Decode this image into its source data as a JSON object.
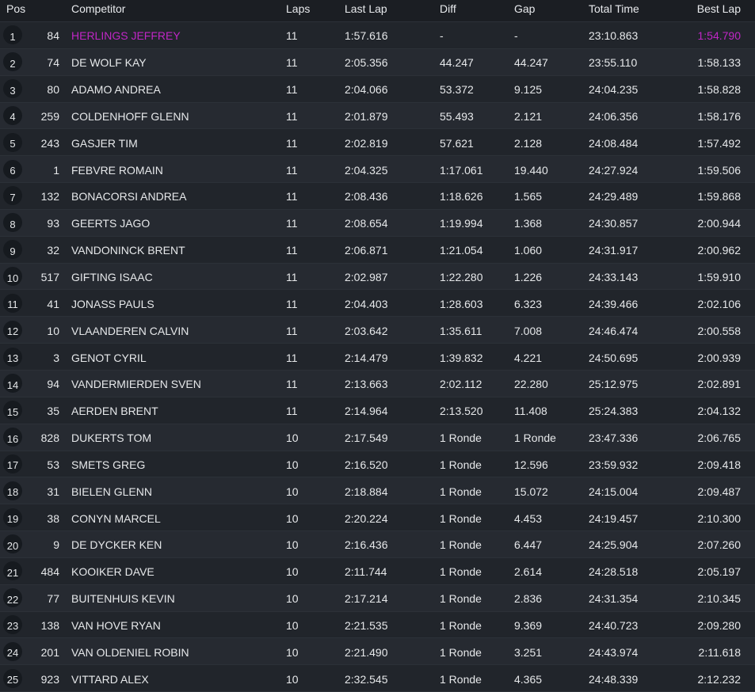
{
  "table": {
    "columns": {
      "pos": "Pos",
      "competitor": "Competitor",
      "laps": "Laps",
      "last_lap": "Last Lap",
      "diff": "Diff",
      "gap": "Gap",
      "total_time": "Total Time",
      "best_lap": "Best Lap"
    },
    "highlight_color": "#c026c6",
    "rows": [
      {
        "pos": "1",
        "number": "84",
        "name": "HERLINGS JEFFREY",
        "laps": "11",
        "last_lap": "1:57.616",
        "diff": "-",
        "gap": "-",
        "total_time": "23:10.863",
        "best_lap": "1:54.790"
      },
      {
        "pos": "2",
        "number": "74",
        "name": "DE WOLF KAY",
        "laps": "11",
        "last_lap": "2:05.356",
        "diff": "44.247",
        "gap": "44.247",
        "total_time": "23:55.110",
        "best_lap": "1:58.133"
      },
      {
        "pos": "3",
        "number": "80",
        "name": "ADAMO ANDREA",
        "laps": "11",
        "last_lap": "2:04.066",
        "diff": "53.372",
        "gap": "9.125",
        "total_time": "24:04.235",
        "best_lap": "1:58.828"
      },
      {
        "pos": "4",
        "number": "259",
        "name": "COLDENHOFF GLENN",
        "laps": "11",
        "last_lap": "2:01.879",
        "diff": "55.493",
        "gap": "2.121",
        "total_time": "24:06.356",
        "best_lap": "1:58.176"
      },
      {
        "pos": "5",
        "number": "243",
        "name": "GASJER TIM",
        "laps": "11",
        "last_lap": "2:02.819",
        "diff": "57.621",
        "gap": "2.128",
        "total_time": "24:08.484",
        "best_lap": "1:57.492"
      },
      {
        "pos": "6",
        "number": "1",
        "name": "FEBVRE ROMAIN",
        "laps": "11",
        "last_lap": "2:04.325",
        "diff": "1:17.061",
        "gap": "19.440",
        "total_time": "24:27.924",
        "best_lap": "1:59.506"
      },
      {
        "pos": "7",
        "number": "132",
        "name": "BONACORSI ANDREA",
        "laps": "11",
        "last_lap": "2:08.436",
        "diff": "1:18.626",
        "gap": "1.565",
        "total_time": "24:29.489",
        "best_lap": "1:59.868"
      },
      {
        "pos": "8",
        "number": "93",
        "name": "GEERTS JAGO",
        "laps": "11",
        "last_lap": "2:08.654",
        "diff": "1:19.994",
        "gap": "1.368",
        "total_time": "24:30.857",
        "best_lap": "2:00.944"
      },
      {
        "pos": "9",
        "number": "32",
        "name": "VANDONINCK BRENT",
        "laps": "11",
        "last_lap": "2:06.871",
        "diff": "1:21.054",
        "gap": "1.060",
        "total_time": "24:31.917",
        "best_lap": "2:00.962"
      },
      {
        "pos": "10",
        "number": "517",
        "name": "GIFTING ISAAC",
        "laps": "11",
        "last_lap": "2:02.987",
        "diff": "1:22.280",
        "gap": "1.226",
        "total_time": "24:33.143",
        "best_lap": "1:59.910"
      },
      {
        "pos": "11",
        "number": "41",
        "name": "JONASS PAULS",
        "laps": "11",
        "last_lap": "2:04.403",
        "diff": "1:28.603",
        "gap": "6.323",
        "total_time": "24:39.466",
        "best_lap": "2:02.106"
      },
      {
        "pos": "12",
        "number": "10",
        "name": "VLAANDEREN CALVIN",
        "laps": "11",
        "last_lap": "2:03.642",
        "diff": "1:35.611",
        "gap": "7.008",
        "total_time": "24:46.474",
        "best_lap": "2:00.558"
      },
      {
        "pos": "13",
        "number": "3",
        "name": "GENOT CYRIL",
        "laps": "11",
        "last_lap": "2:14.479",
        "diff": "1:39.832",
        "gap": "4.221",
        "total_time": "24:50.695",
        "best_lap": "2:00.939"
      },
      {
        "pos": "14",
        "number": "94",
        "name": "VANDERMIERDEN SVEN",
        "laps": "11",
        "last_lap": "2:13.663",
        "diff": "2:02.112",
        "gap": "22.280",
        "total_time": "25:12.975",
        "best_lap": "2:02.891"
      },
      {
        "pos": "15",
        "number": "35",
        "name": "AERDEN BRENT",
        "laps": "11",
        "last_lap": "2:14.964",
        "diff": "2:13.520",
        "gap": "11.408",
        "total_time": "25:24.383",
        "best_lap": "2:04.132"
      },
      {
        "pos": "16",
        "number": "828",
        "name": "DUKERTS TOM",
        "laps": "10",
        "last_lap": "2:17.549",
        "diff": "1 Ronde",
        "gap": "1 Ronde",
        "total_time": "23:47.336",
        "best_lap": "2:06.765"
      },
      {
        "pos": "17",
        "number": "53",
        "name": "SMETS GREG",
        "laps": "10",
        "last_lap": "2:16.520",
        "diff": "1 Ronde",
        "gap": "12.596",
        "total_time": "23:59.932",
        "best_lap": "2:09.418"
      },
      {
        "pos": "18",
        "number": "31",
        "name": "BIELEN GLENN",
        "laps": "10",
        "last_lap": "2:18.884",
        "diff": "1 Ronde",
        "gap": "15.072",
        "total_time": "24:15.004",
        "best_lap": "2:09.487"
      },
      {
        "pos": "19",
        "number": "38",
        "name": "CONYN MARCEL",
        "laps": "10",
        "last_lap": "2:20.224",
        "diff": "1 Ronde",
        "gap": "4.453",
        "total_time": "24:19.457",
        "best_lap": "2:10.300"
      },
      {
        "pos": "20",
        "number": "9",
        "name": "DE DYCKER KEN",
        "laps": "10",
        "last_lap": "2:16.436",
        "diff": "1 Ronde",
        "gap": "6.447",
        "total_time": "24:25.904",
        "best_lap": "2:07.260"
      },
      {
        "pos": "21",
        "number": "484",
        "name": "KOOIKER DAVE",
        "laps": "10",
        "last_lap": "2:11.744",
        "diff": "1 Ronde",
        "gap": "2.614",
        "total_time": "24:28.518",
        "best_lap": "2:05.197"
      },
      {
        "pos": "22",
        "number": "77",
        "name": "BUITENHUIS KEVIN",
        "laps": "10",
        "last_lap": "2:17.214",
        "diff": "1 Ronde",
        "gap": "2.836",
        "total_time": "24:31.354",
        "best_lap": "2:10.345"
      },
      {
        "pos": "23",
        "number": "138",
        "name": "VAN HOVE RYAN",
        "laps": "10",
        "last_lap": "2:21.535",
        "diff": "1 Ronde",
        "gap": "9.369",
        "total_time": "24:40.723",
        "best_lap": "2:09.280"
      },
      {
        "pos": "24",
        "number": "201",
        "name": "VAN OLDENIEL ROBIN",
        "laps": "10",
        "last_lap": "2:21.490",
        "diff": "1 Ronde",
        "gap": "3.251",
        "total_time": "24:43.974",
        "best_lap": "2:11.618"
      },
      {
        "pos": "25",
        "number": "923",
        "name": "VITTARD ALEX",
        "laps": "10",
        "last_lap": "2:32.545",
        "diff": "1 Ronde",
        "gap": "4.365",
        "total_time": "24:48.339",
        "best_lap": "2:12.232"
      }
    ]
  }
}
